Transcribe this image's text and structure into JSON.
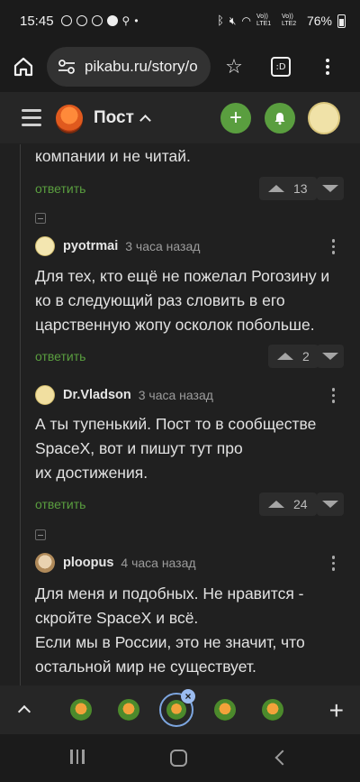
{
  "status_bar": {
    "time": "15:45",
    "battery": "76%",
    "icons": [
      "pikabu-notification-icon",
      "alarm-icon",
      "pikabu-notification-icon",
      "user-icon",
      "keyhole-icon",
      "dot-icon",
      "bluetooth-icon",
      "mute-icon",
      "wifi-icon",
      "volte-signal-icon",
      "volte-signal-icon",
      "battery-icon"
    ],
    "volte_label": "Vo)) LTE1",
    "volte2_label": "Vo)) LTE2"
  },
  "browser": {
    "url": "pikabu.ru/story/o",
    "tab_count": ":D"
  },
  "site_header": {
    "title": "Пост",
    "add_label": "+",
    "accent_color": "#5a9e3f"
  },
  "comments": [
    {
      "text": "компании и не читай.",
      "reply_label": "ответить",
      "rating": "13"
    },
    {
      "author": "pyotrmai",
      "time": "3 часа назад",
      "text": "Для тех, кто ещё не пожелал Рогозину и ко в следующий раз словить в его царственную жопу осколок побольше.",
      "reply_label": "ответить",
      "rating": "2"
    },
    {
      "author": "Dr.Vladson",
      "time": "3 часа назад",
      "text_lines": [
        "А ты тупенький. Пост то в сообществе",
        "SpaceX, вот и пишут тут про",
        "их достижения."
      ],
      "reply_label": "ответить",
      "rating": "24"
    },
    {
      "author": "ploopus",
      "time": "4 часа назад",
      "text_lines": [
        "Для меня и подобных. Не нравится -",
        "скройте SpaceX и всё.",
        "Если мы в России, это не значит, что",
        "остальной мир не существует."
      ]
    }
  ],
  "tab_strip": {
    "close_label": "×",
    "plus_label": "+"
  }
}
